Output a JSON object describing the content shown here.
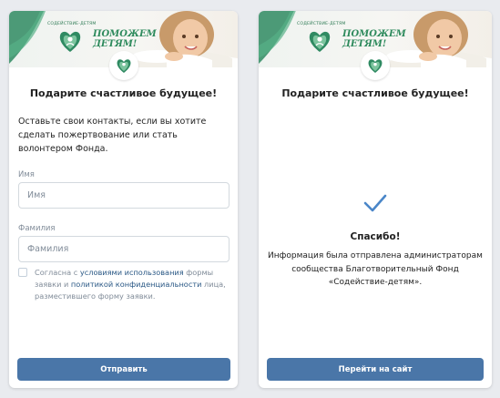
{
  "brand": {
    "logo_caption": "СОДЕЙСТВИЕ-ДЕТЯМ",
    "slogan_line1": "ПОМОЖЕМ",
    "slogan_line2": "ДЕТЯМ!",
    "color_primary": "#2d8a5c",
    "color_dark": "#1f5e44"
  },
  "form_card": {
    "title": "Подарите счастливое будущее!",
    "intro": "Оставьте свои контакты, если вы хотите сделать пожертвование или стать волонтером Фонда.",
    "first_name": {
      "label": "Имя",
      "placeholder": "Имя",
      "value": ""
    },
    "last_name": {
      "label": "Фамилия",
      "placeholder": "Фамилия",
      "value": ""
    },
    "consent": {
      "checked": false,
      "text_before": "Согласна с ",
      "link_terms": "условиями использования",
      "text_middle": " формы заявки и ",
      "link_privacy": "политикой конфиденциальности",
      "text_after": " лица, разместившего форму заявки."
    },
    "submit_label": "Отправить"
  },
  "success_card": {
    "title": "Подарите счастливое будущее!",
    "thanks": "Спасибо!",
    "message": "Информация была отправлена администраторам сообщества Благотворительный Фонд «Содействие-детям».",
    "button_label": "Перейти на сайт"
  },
  "colors": {
    "background": "#e9ebef",
    "button": "#4a76a8",
    "link": "#2a5885",
    "muted": "#818c99",
    "check": "#4a86c8"
  }
}
